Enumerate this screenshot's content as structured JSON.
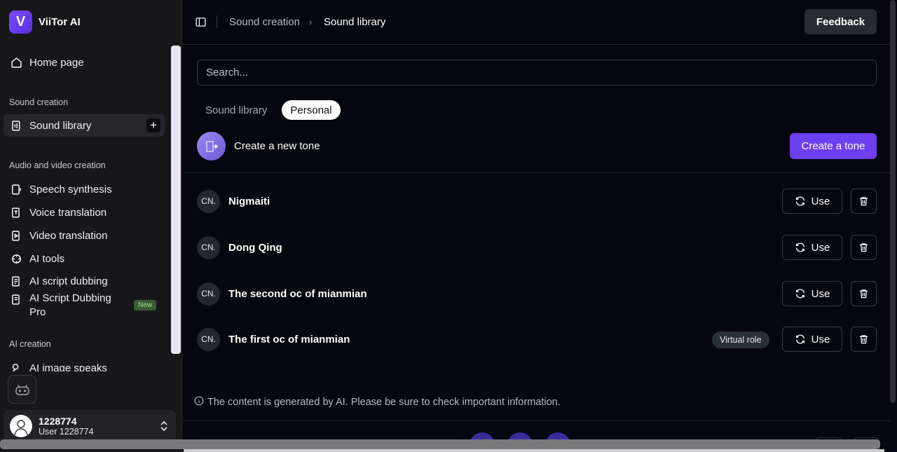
{
  "brand": {
    "logo_letter": "V",
    "name": "ViiTor AI"
  },
  "sidebar": {
    "home": "Home page",
    "section_sound": "Sound creation",
    "sound_library": "Sound library",
    "section_av": "Audio and video creation",
    "items": [
      "Speech synthesis",
      "Voice translation",
      "Video translation",
      "AI tools",
      "AI script dubbing",
      "AI Script Dubbing Pro"
    ],
    "new_badge": "New",
    "section_ai": "AI creation",
    "ai_item": "AI image speaks"
  },
  "user": {
    "id": "1228774",
    "subtitle": "User 1228774"
  },
  "header": {
    "breadcrumb_parent": "Sound creation",
    "breadcrumb_current": "Sound library",
    "feedback": "Feedback"
  },
  "search": {
    "placeholder": "Search..."
  },
  "tabs": [
    {
      "label": "Sound library",
      "active": false
    },
    {
      "label": "Personal",
      "active": true
    }
  ],
  "create": {
    "text": "Create a new tone",
    "button": "Create a tone"
  },
  "voices": [
    {
      "lang": "CN.",
      "name": "Nigmaiti",
      "tag": ""
    },
    {
      "lang": "CN.",
      "name": "Dong Qing",
      "tag": ""
    },
    {
      "lang": "CN.",
      "name": "The second oc of mianmian",
      "tag": ""
    },
    {
      "lang": "CN.",
      "name": "The first oc of mianmian",
      "tag": "Virtual role"
    }
  ],
  "row_actions": {
    "use": "Use"
  },
  "footer_note": "The content is generated by AI. Please be sure to check important information.",
  "colors": {
    "accent": "#6e3ff0",
    "background": "#05060f",
    "sidebar": "#17171a"
  }
}
